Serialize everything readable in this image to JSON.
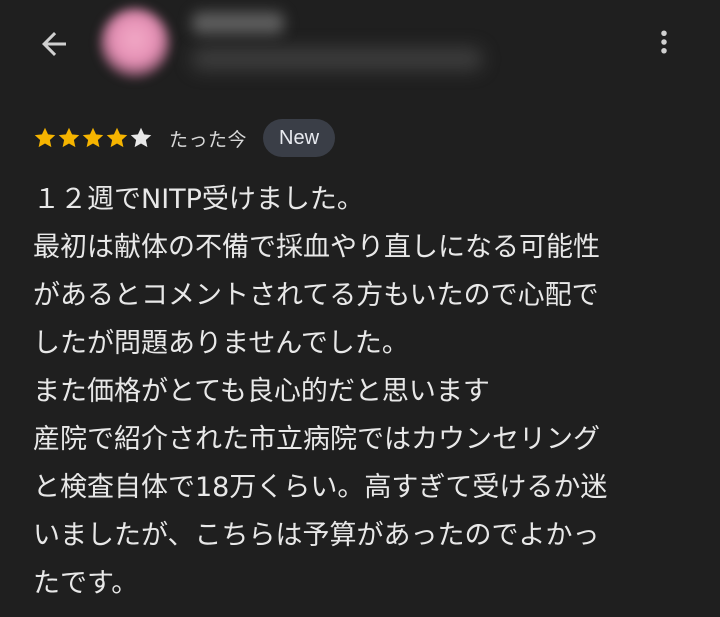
{
  "header": {
    "back_icon": "arrow-left-icon",
    "more_icon": "more-vert-icon"
  },
  "review": {
    "rating": 4,
    "max_rating": 5,
    "time": "たった今",
    "badge": "New",
    "colors": {
      "star_filled": "#f5b400",
      "star_empty": "#e8e8e8",
      "badge_bg": "#3a3e47",
      "background": "#1f1f1f"
    },
    "lines": [
      "１２週でNITP受けました。",
      "最初は献体の不備で採血やり直しになる可能性",
      "があるとコメントされてる方もいたので心配で",
      "したが問題ありませんでした。",
      "また価格がとても良心的だと思います",
      "産院で紹介された市立病院ではカウンセリング",
      "と検査自体で18万くらい。高すぎて受けるか迷",
      "いましたが、こちらは予算があったのでよかっ",
      "たです。"
    ]
  }
}
